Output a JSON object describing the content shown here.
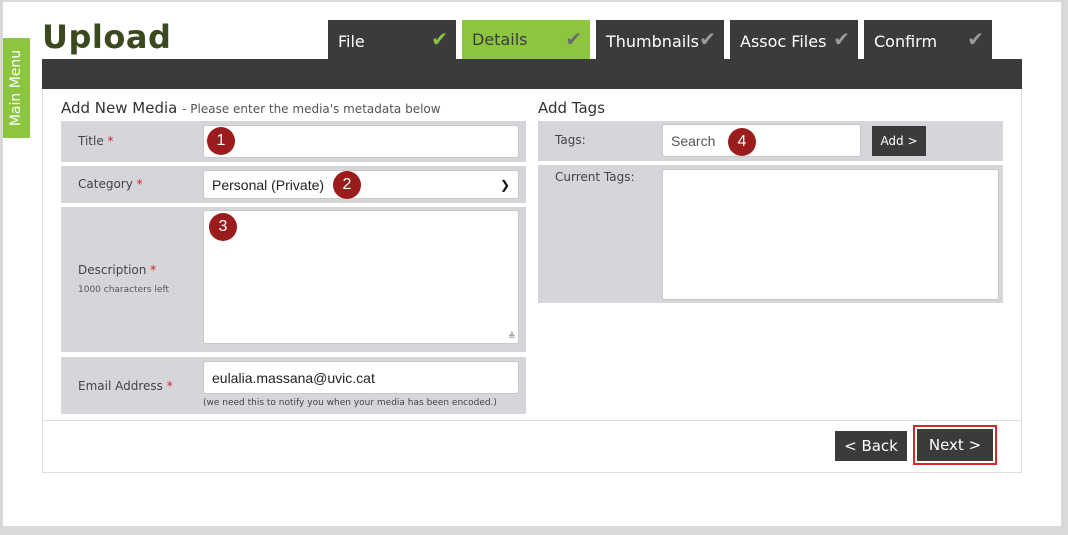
{
  "sidebar": {
    "label": "Main Menu"
  },
  "header": {
    "title": "Upload"
  },
  "steps": [
    {
      "label": "File",
      "state": "done"
    },
    {
      "label": "Details",
      "state": "active"
    },
    {
      "label": "Thumbnails",
      "state": "pending"
    },
    {
      "label": "Assoc Files",
      "state": "pending"
    },
    {
      "label": "Confirm",
      "state": "pending"
    }
  ],
  "check_glyph": "✔",
  "required_marker": "*",
  "media": {
    "heading": "Add New Media",
    "subheading": "- Please enter the media's metadata below",
    "title_label": "Title",
    "title_value": "",
    "category_label": "Category",
    "category_value": "Personal (Private)",
    "description_label": "Description",
    "description_hint": "1000 characters left",
    "description_value": "",
    "email_label": "Email Address",
    "email_value": "eulalia.massana@uvic.cat",
    "email_note": "(we need this to notify you when your media has been encoded.)"
  },
  "tags": {
    "heading": "Add Tags",
    "tags_label": "Tags:",
    "search_placeholder": "Search",
    "add_button": "Add >",
    "current_label": "Current Tags:"
  },
  "annotations": [
    "1",
    "2",
    "3",
    "4"
  ],
  "footer": {
    "back_button": "< Back",
    "next_button": "Next >"
  },
  "colors": {
    "accent": "#8cc63f",
    "dark": "#3b3b3b",
    "annotation": "#9b1c1c",
    "highlight": "#d9272e",
    "title": "#3a4a1e"
  }
}
